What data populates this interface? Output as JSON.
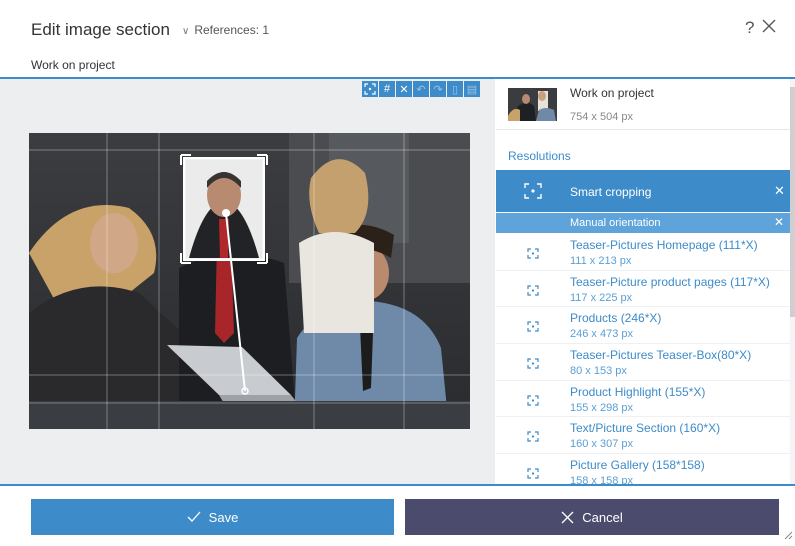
{
  "header": {
    "title": "Edit image section",
    "references": "References: 1",
    "help": "?",
    "subtitle": "Work on project"
  },
  "toolbar": {
    "icons": [
      "smart-crop-icon",
      "crop-icon",
      "close-icon",
      "undo-icon",
      "redo-icon",
      "flip-icon",
      "split-icon"
    ]
  },
  "image": {
    "name": "Work on project",
    "size": "754 x 504 px"
  },
  "resolutions": {
    "heading": "Resolutions",
    "smart_label": "Smart cropping",
    "manual_label": "Manual orientation",
    "items": [
      {
        "name": "Teaser-Pictures Homepage (111*X)",
        "size": "111 x 213 px"
      },
      {
        "name": "Teaser-Picture product pages (117*X)",
        "size": "117 x 225 px"
      },
      {
        "name": "Products (246*X)",
        "size": "246 x 473 px"
      },
      {
        "name": "Teaser-Pictures Teaser-Box(80*X)",
        "size": "80 x 153 px"
      },
      {
        "name": "Product Highlight (155*X)",
        "size": "155 x 298 px"
      },
      {
        "name": "Text/Picture Section (160*X)",
        "size": "160 x 307 px"
      },
      {
        "name": "Picture Gallery (158*158)",
        "size": "158 x 158 px"
      }
    ]
  },
  "footer": {
    "save_label": "Save",
    "cancel_label": "Cancel"
  },
  "colors": {
    "accent": "#3d8bc9",
    "cancel": "#4b4b6e",
    "selected_sub": "#5ea4da"
  }
}
